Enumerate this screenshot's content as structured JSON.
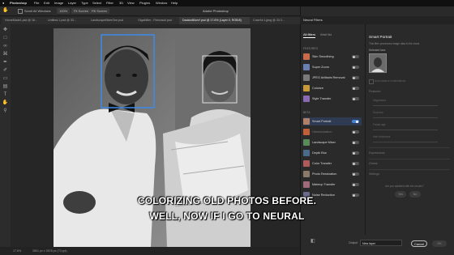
{
  "menubar": {
    "apple": "",
    "items": [
      "Photoshop",
      "File",
      "Edit",
      "Image",
      "Layer",
      "Type",
      "Select",
      "Filter",
      "3D",
      "View",
      "Plugins",
      "Window",
      "Help"
    ],
    "window_title": "Adobe Photoshop"
  },
  "options_bar": {
    "scroll_all": "Scroll All Windows",
    "zoom_percent": "100%",
    "fit_screen": "Fit Screen",
    "fill_screen": "Fill Screen"
  },
  "tabs": [
    "HomeMade1.psd @ 16...",
    "Untitled-1.psd @ 33...",
    "LandscapeMixerOne.psd",
    "OlgaMiller - Firecrackl.psd",
    "DadandMom*.psd @ 17.6% (Layer 0, RGB/8)",
    "Colorful 1.jpeg @ 33.3..."
  ],
  "status": {
    "zoom": "17.6%",
    "doc_info": "2801 px x 3578 px (72 ppi)"
  },
  "tool_icons": [
    "move-icon",
    "marquee-icon",
    "lasso-icon",
    "crop-icon",
    "eyedropper-icon",
    "brush-icon",
    "eraser-icon",
    "gradient-icon",
    "type-icon",
    "hand-icon",
    "zoom-icon"
  ],
  "panel": {
    "title": "Neural Filters",
    "tabs": {
      "all": "All filters",
      "wait": "Wait list"
    },
    "featured_label": "FEATURED",
    "beta_label": "BETA",
    "featured": [
      {
        "label": "Skin Smoothing",
        "color": "#c86b4a"
      },
      {
        "label": "Super Zoom",
        "color": "#6a7fb0"
      },
      {
        "label": "JPEG Artifacts Removal",
        "color": "#7a7a7a"
      },
      {
        "label": "Colorize",
        "color": "#c79a3a"
      },
      {
        "label": "Style Transfer",
        "color": "#8a6ab0"
      }
    ],
    "beta": [
      {
        "label": "Smart Portrait",
        "color": "#b0806a",
        "selected": true
      },
      {
        "label": "Harmonization",
        "color": "#c0603a"
      },
      {
        "label": "Landscape Mixer",
        "color": "#5a8a5a"
      },
      {
        "label": "Depth Blur",
        "color": "#4a6a8a"
      },
      {
        "label": "Color Transfer",
        "color": "#b05a5a"
      },
      {
        "label": "Photo Restoration",
        "color": "#8a7a6a"
      },
      {
        "label": "Makeup Transfer",
        "color": "#a06a7a"
      },
      {
        "label": "Noise Reduction",
        "color": "#6a6a8a"
      }
    ],
    "detail": {
      "title": "Smart Portrait",
      "subtitle": "This filter processes image data in the cloud",
      "selected_face": "Selected face",
      "auto_balance": "Auto balance combinations",
      "featured": "Featured",
      "sliders": [
        "Happiness",
        "Surprise",
        "Facial age",
        "Hair thickness",
        "Eye direction"
      ],
      "expressions": "Expressions",
      "global": "Global",
      "settings": "Settings",
      "feedback": "Are you satisfied with the results?",
      "yes": "Yes",
      "no": "No"
    },
    "footer": {
      "output_label": "Output",
      "output_value": "New layer",
      "cancel": "Cancel",
      "ok": "OK"
    }
  },
  "caption": {
    "line1": "COLORIZING OLD PHOTOS BEFORE.",
    "line2": "WELL, NOW IF I GO TO NEURAL"
  },
  "colors": {
    "accent": "#4a82d4",
    "panel_bg": "#2a2a2a"
  }
}
